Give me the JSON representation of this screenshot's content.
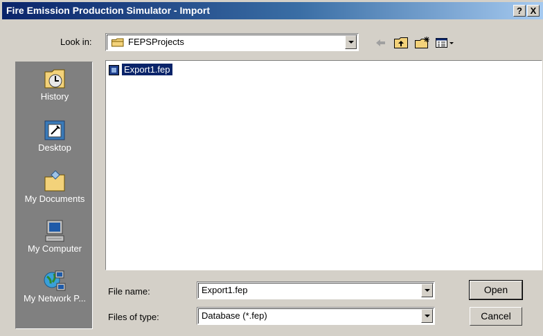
{
  "window": {
    "title": "Fire Emission Production Simulator - Import",
    "help_label": "?",
    "close_label": "X"
  },
  "lookin": {
    "label": "Look in:",
    "value": "FEPSProjects"
  },
  "places": [
    {
      "label": "History",
      "icon": "history-icon"
    },
    {
      "label": "Desktop",
      "icon": "desktop-icon"
    },
    {
      "label": "My Documents",
      "icon": "my-documents-icon"
    },
    {
      "label": "My Computer",
      "icon": "my-computer-icon"
    },
    {
      "label": "My Network P...",
      "icon": "my-network-places-icon"
    }
  ],
  "files": [
    {
      "name": "Export1.fep",
      "selected": true
    }
  ],
  "filename": {
    "label": "File name:",
    "value": "Export1.fep"
  },
  "filetype": {
    "label": "Files of type:",
    "value": "Database (*.fep)"
  },
  "buttons": {
    "open": "Open",
    "cancel": "Cancel"
  },
  "colors": {
    "title_bar_start": "#0a246a",
    "title_bar_end": "#a6caf0",
    "dialog_face": "#d4d0c8",
    "places_bar": "#808080",
    "selection": "#0a246a"
  }
}
